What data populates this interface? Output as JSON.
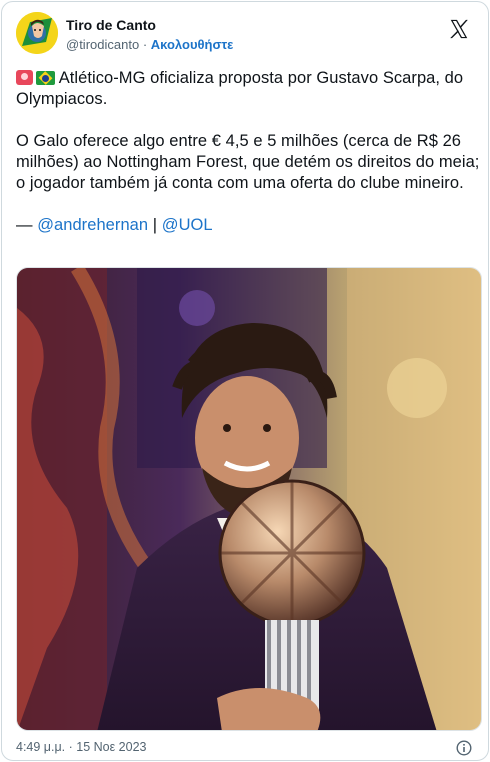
{
  "author": {
    "display_name": "Tiro de Canto",
    "handle": "@tirodicanto",
    "separator": "·",
    "follow_label": "Ακολουθήστε"
  },
  "tweet": {
    "line1_text": "Atlético-MG oficializa proposta por Gustavo Scarpa, do Olympiacos.",
    "paragraph2": "O Galo oferece algo entre € 4,5 e  5 milhões (cerca de R$ 26 milhões) ao Nottingham Forest, que detém os direitos do meia; o jogador também já conta com uma oferta do clube mineiro.",
    "credit_dash": "—",
    "credit_user": "@andrehernan",
    "credit_sep": "|",
    "credit_outlet": "@UOL"
  },
  "footer": {
    "timestamp": "4:49 μ.μ. · 15 Νοε 2023"
  },
  "icons": {
    "logo": "x-logo-icon",
    "info": "info-icon",
    "siren": "siren-emoji-icon",
    "flag": "brazil-flag-emoji-icon"
  },
  "colors": {
    "link": "#1d74c9",
    "secondary_text": "#536471",
    "border": "#cfd9de"
  }
}
